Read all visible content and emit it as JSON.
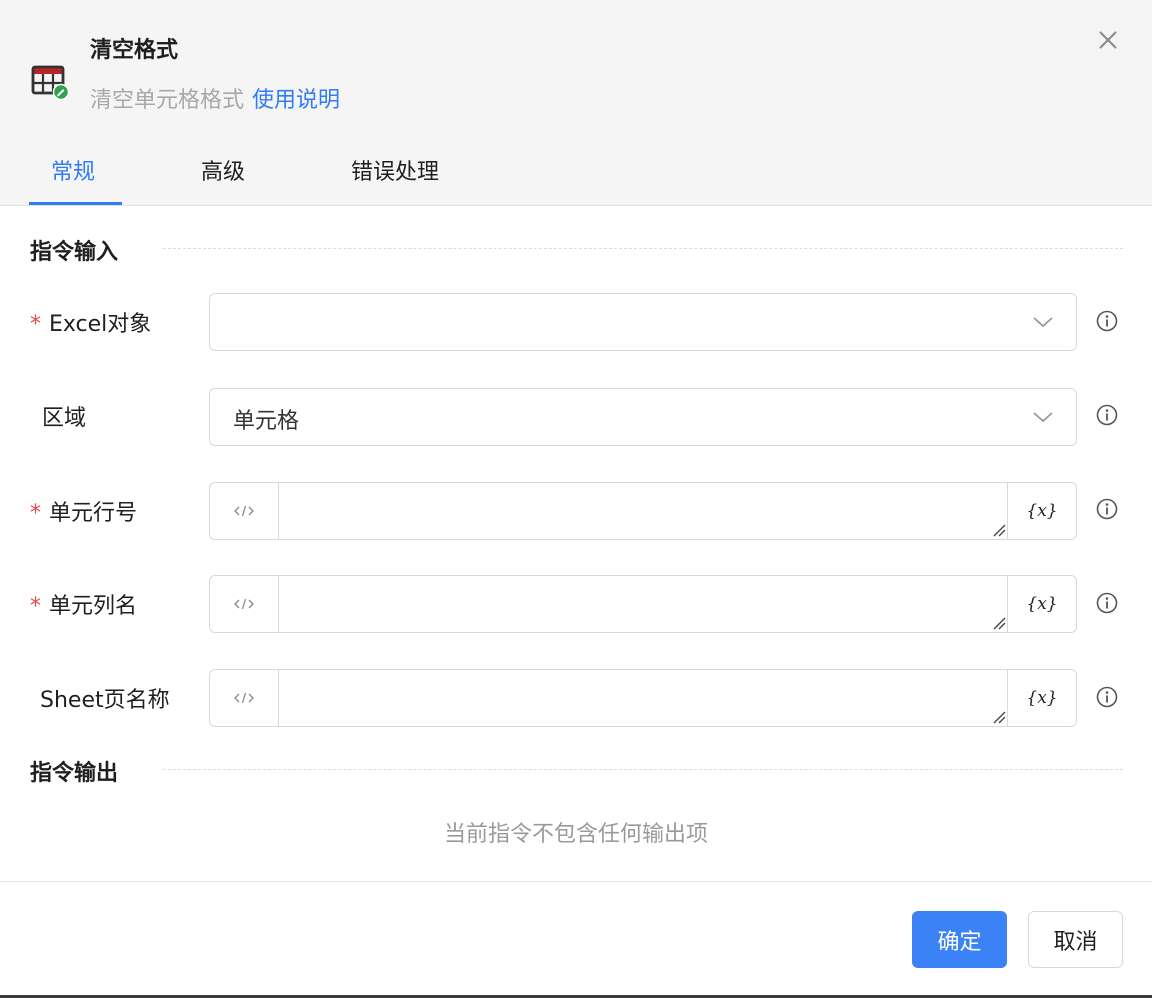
{
  "dialog": {
    "title": "清空格式",
    "subtitle": "清空单元格格式",
    "help_link": "使用说明",
    "icon": "excel-table-clear-icon"
  },
  "tabs": [
    {
      "label": "常规",
      "active": true
    },
    {
      "label": "高级",
      "active": false
    },
    {
      "label": "错误处理",
      "active": false
    }
  ],
  "input_section": {
    "title": "指令输入",
    "fields": [
      {
        "label": "Excel对象",
        "required": true,
        "type": "select",
        "value": ""
      },
      {
        "label": "区域",
        "required": false,
        "type": "select",
        "value": "单元格"
      },
      {
        "label": "单元行号",
        "required": true,
        "type": "expression",
        "value": "",
        "var_button": "{x}"
      },
      {
        "label": "单元列名",
        "required": true,
        "type": "expression",
        "value": "",
        "var_button": "{x}"
      },
      {
        "label": "Sheet页名称",
        "required": false,
        "type": "expression",
        "value": "",
        "var_button": "{x}"
      }
    ]
  },
  "output_section": {
    "title": "指令输出",
    "empty_text": "当前指令不包含任何输出项"
  },
  "footer": {
    "ok_label": "确定",
    "cancel_label": "取消"
  },
  "colors": {
    "accent": "#2f7cf6",
    "primary_button": "#3b82f6",
    "required_mark": "#e5484d",
    "header_bg": "#f5f5f5"
  }
}
